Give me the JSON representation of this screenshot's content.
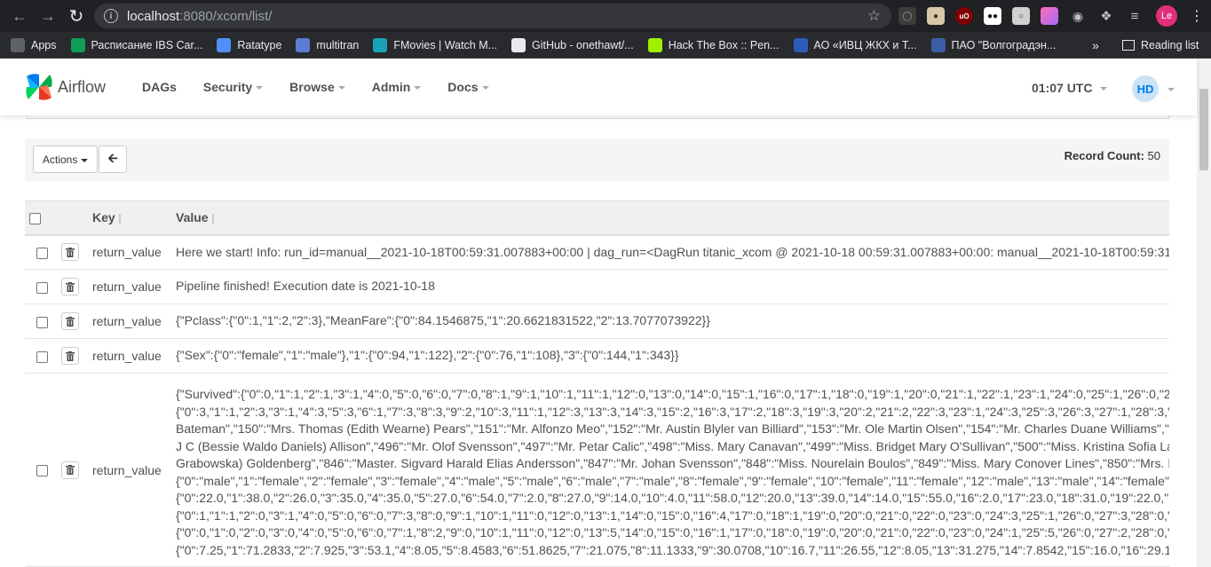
{
  "browser": {
    "url_host": "localhost",
    "url_rest": ":8080/xcom/list/",
    "bookmarks": [
      {
        "label": "Apps",
        "icon": "apps-grid-icon",
        "color": "#5f6368"
      },
      {
        "label": "Расписание IBS Car...",
        "icon": "sheets-icon",
        "color": "#0f9d58"
      },
      {
        "label": "Ratatype",
        "icon": "ratatype-icon",
        "color": "#4f8ff7"
      },
      {
        "label": "multitran",
        "icon": "multitran-icon",
        "color": "#5b7bd5"
      },
      {
        "label": "FMovies | Watch M...",
        "icon": "fmovies-icon",
        "color": "#1aa3b8"
      },
      {
        "label": "GitHub - onethawt/...",
        "icon": "github-icon",
        "color": "#e8eaed"
      },
      {
        "label": "Hack The Box :: Pen...",
        "icon": "htb-icon",
        "color": "#9fef00"
      },
      {
        "label": "АО «ИВЦ ЖКХ и Т...",
        "icon": "ivc-icon",
        "color": "#2b5cb8"
      },
      {
        "label": "ПАО \"Волгоградэн...",
        "icon": "volga-icon",
        "color": "#3a5fa8"
      }
    ],
    "bookmarks_more": "»",
    "reading_list": "Reading list",
    "profile_initials": "Le"
  },
  "airflow": {
    "brand": "Airflow",
    "menu": [
      {
        "label": "DAGs",
        "dropdown": false
      },
      {
        "label": "Security",
        "dropdown": true
      },
      {
        "label": "Browse",
        "dropdown": true
      },
      {
        "label": "Admin",
        "dropdown": true
      },
      {
        "label": "Docs",
        "dropdown": true
      }
    ],
    "clock": "01:07 UTC",
    "user_initials": "HD"
  },
  "toolbar": {
    "actions_label": "Actions",
    "record_count_label": "Record Count:",
    "record_count_value": "50"
  },
  "table": {
    "headers": {
      "key": "Key",
      "value": "Value"
    },
    "rows": [
      {
        "key": "return_value",
        "value": [
          "Here we start! Info: run_id=manual__2021-10-18T00:59:31.007883+00:00 | dag_run=<DagRun titanic_xcom @ 2021-10-18 00:59:31.007883+00:00: manual__2021-10-18T00:59:31"
        ]
      },
      {
        "key": "return_value",
        "value": [
          "Pipeline finished! Execution date is 2021-10-18"
        ]
      },
      {
        "key": "return_value",
        "value": [
          "{\"Pclass\":{\"0\":1,\"1\":2,\"2\":3},\"MeanFare\":{\"0\":84.1546875,\"1\":20.6621831522,\"2\":13.7077073922}}"
        ]
      },
      {
        "key": "return_value",
        "value": [
          "{\"Sex\":{\"0\":\"female\",\"1\":\"male\"},\"1\":{\"0\":94,\"1\":122},\"2\":{\"0\":76,\"1\":108},\"3\":{\"0\":144,\"1\":343}}"
        ]
      },
      {
        "key": "return_value",
        "value": [
          "{\"Survived\":{\"0\":0,\"1\":1,\"2\":1,\"3\":1,\"4\":0,\"5\":0,\"6\":0,\"7\":0,\"8\":1,\"9\":1,\"10\":1,\"11\":1,\"12\":0,\"13\":0,\"14\":0,\"15\":1,\"16\":0,\"17\":1,\"18\":0,\"19\":1,\"20\":0,\"21\":1,\"22\":1,\"23\":1,\"24\":0,\"25\":1,\"26\":0,\"2",
          "{\"0\":3,\"1\":1,\"2\":3,\"3\":1,\"4\":3,\"5\":3,\"6\":1,\"7\":3,\"8\":3,\"9\":2,\"10\":3,\"11\":1,\"12\":3,\"13\":3,\"14\":3,\"15\":2,\"16\":3,\"17\":2,\"18\":3,\"19\":3,\"20\":2,\"21\":2,\"22\":3,\"23\":1,\"24\":3,\"25\":3,\"26\":3,\"27\":1,\"28\":3,\"",
          "Bateman\",\"150\":\"Mrs. Thomas (Edith Wearne) Pears\",\"151\":\"Mr. Alfonzo Meo\",\"152\":\"Mr. Austin Blyler van Billiard\",\"153\":\"Mr. Ole Martin Olsen\",\"154\":\"Mr. Charles Duane Williams\",\"",
          "J C (Bessie Waldo Daniels) Allison\",\"496\":\"Mr. Olof Svensson\",\"497\":\"Mr. Petar Calic\",\"498\":\"Miss. Mary Canavan\",\"499\":\"Miss. Bridget Mary O'Sullivan\",\"500\":\"Miss. Kristina Sofia La",
          "Grabowska) Goldenberg\",\"846\":\"Master. Sigvard Harald Elias Andersson\",\"847\":\"Mr. Johan Svensson\",\"848\":\"Miss. Nourelain Boulos\",\"849\":\"Miss. Mary Conover Lines\",\"850\":\"Mrs. I",
          "{\"0\":\"male\",\"1\":\"female\",\"2\":\"female\",\"3\":\"female\",\"4\":\"male\",\"5\":\"male\",\"6\":\"male\",\"7\":\"male\",\"8\":\"female\",\"9\":\"female\",\"10\":\"female\",\"11\":\"female\",\"12\":\"male\",\"13\":\"male\",\"14\":\"female\"",
          "{\"0\":22.0,\"1\":38.0,\"2\":26.0,\"3\":35.0,\"4\":35.0,\"5\":27.0,\"6\":54.0,\"7\":2.0,\"8\":27.0,\"9\":14.0,\"10\":4.0,\"11\":58.0,\"12\":20.0,\"13\":39.0,\"14\":14.0,\"15\":55.0,\"16\":2.0,\"17\":23.0,\"18\":31.0,\"19\":22.0,\"",
          "{\"0\":1,\"1\":1,\"2\":0,\"3\":1,\"4\":0,\"5\":0,\"6\":0,\"7\":3,\"8\":0,\"9\":1,\"10\":1,\"11\":0,\"12\":0,\"13\":1,\"14\":0,\"15\":0,\"16\":4,\"17\":0,\"18\":1,\"19\":0,\"20\":0,\"21\":0,\"22\":0,\"23\":0,\"24\":3,\"25\":1,\"26\":0,\"27\":3,\"28\":0,\"",
          "{\"0\":0,\"1\":0,\"2\":0,\"3\":0,\"4\":0,\"5\":0,\"6\":0,\"7\":1,\"8\":2,\"9\":0,\"10\":1,\"11\":0,\"12\":0,\"13\":5,\"14\":0,\"15\":0,\"16\":1,\"17\":0,\"18\":0,\"19\":0,\"20\":0,\"21\":0,\"22\":0,\"23\":0,\"24\":1,\"25\":5,\"26\":0,\"27\":2,\"28\":0,\"",
          "{\"0\":7.25,\"1\":71.2833,\"2\":7.925,\"3\":53.1,\"4\":8.05,\"5\":8.4583,\"6\":51.8625,\"7\":21.075,\"8\":11.1333,\"9\":30.0708,\"10\":16.7,\"11\":26.55,\"12\":8.05,\"13\":31.275,\"14\":7.8542,\"15\":16.0,\"16\":29.1"
        ]
      }
    ]
  }
}
